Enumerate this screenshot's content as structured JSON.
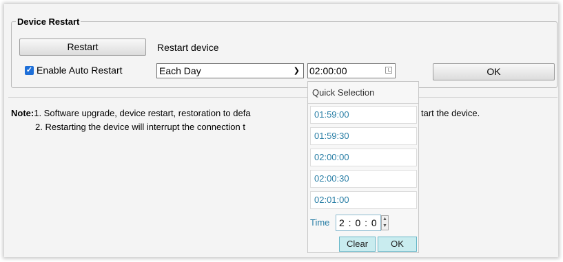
{
  "section": {
    "title": "Device Restart"
  },
  "restart": {
    "button_label": "Restart",
    "description": "Restart device"
  },
  "auto_restart": {
    "checked": true,
    "label": "Enable Auto Restart"
  },
  "frequency": {
    "selected": "Each Day"
  },
  "time": {
    "value": "02:00:00"
  },
  "ok_label": "OK",
  "note": {
    "label": "Note:",
    "line1": "1. Software upgrade, device restart, restoration to defa",
    "line1_tail": "tart the device.",
    "line2": "2. Restarting the device will interrupt the connection t"
  },
  "picker": {
    "title": "Quick Selection",
    "options": [
      "01:59:00",
      "01:59:30",
      "02:00:00",
      "02:00:30",
      "02:01:00"
    ],
    "time_label": "Time",
    "time_value": "2 : 0 : 0",
    "clear_label": "Clear",
    "ok_label": "OK"
  },
  "icons": {
    "check": "checkmark-icon",
    "dropdown": "chevron-down-icon",
    "clock": "clock-icon",
    "up": "spin-up-icon",
    "down": "spin-down-icon"
  }
}
